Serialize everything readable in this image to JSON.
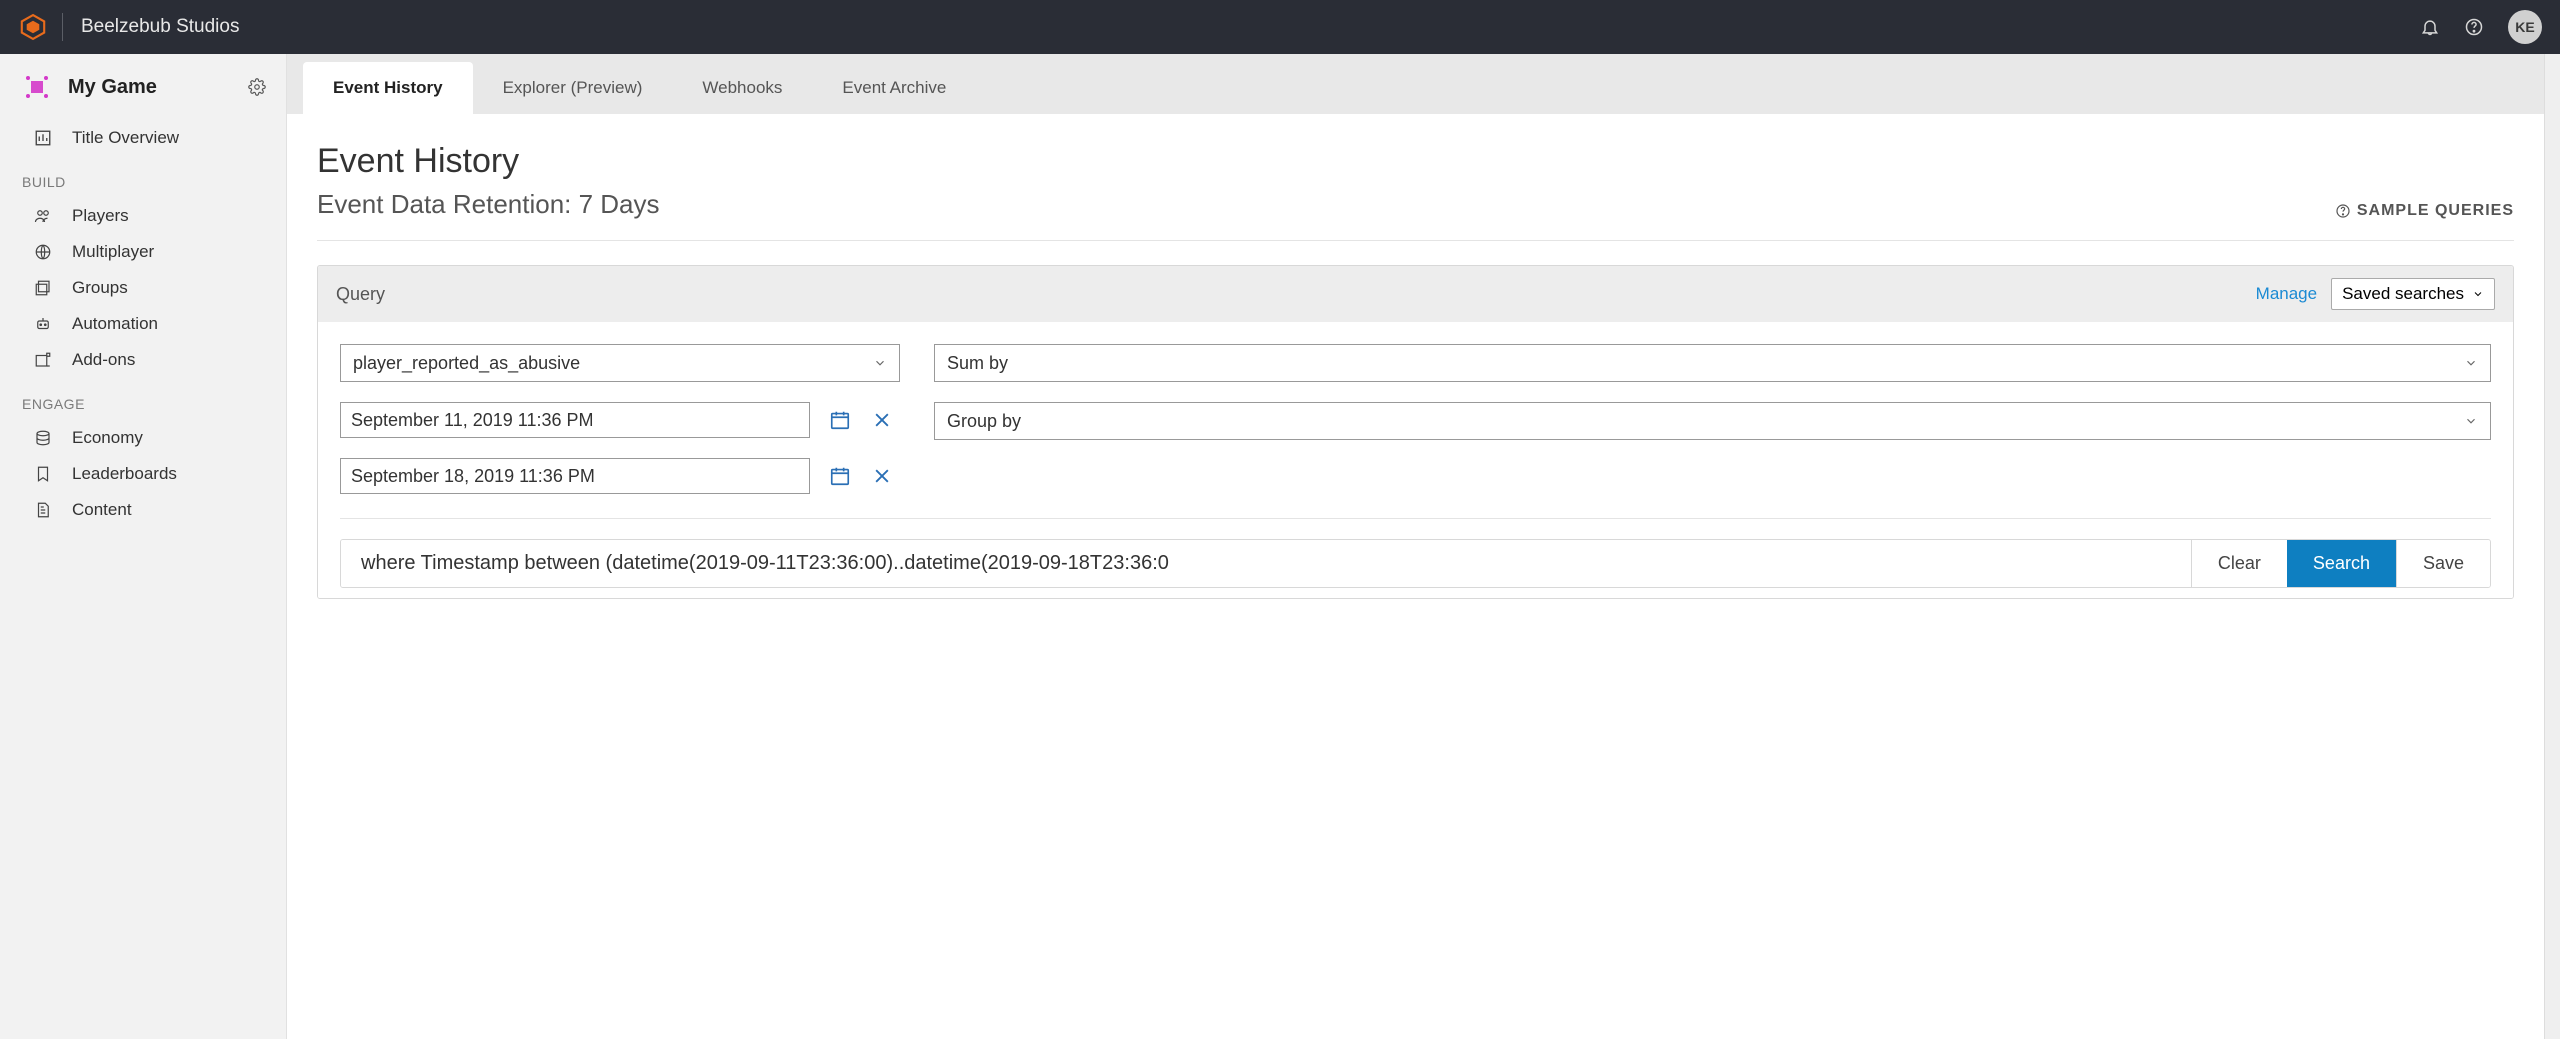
{
  "header": {
    "studio_name": "Beelzebub Studios",
    "user_initials": "KE"
  },
  "sidebar": {
    "project_name": "My Game",
    "items_title_overview": "Title Overview",
    "build_heading": "BUILD",
    "build_items": {
      "players": "Players",
      "multiplayer": "Multiplayer",
      "groups": "Groups",
      "automation": "Automation",
      "addons": "Add-ons"
    },
    "engage_heading": "ENGAGE",
    "engage_items": {
      "economy": "Economy",
      "leaderboards": "Leaderboards",
      "content": "Content"
    }
  },
  "tabs": {
    "event_history": "Event History",
    "explorer": "Explorer (Preview)",
    "webhooks": "Webhooks",
    "event_archive": "Event Archive"
  },
  "page": {
    "title": "Event History",
    "subtitle": "Event Data Retention: 7 Days",
    "sample_queries": "SAMPLE QUERIES"
  },
  "query_panel": {
    "title": "Query",
    "manage": "Manage",
    "saved_searches_label": "Saved searches",
    "event_name": "player_reported_as_abusive",
    "sum_by": "Sum by",
    "group_by": "Group by",
    "start_date": "September 11, 2019 11:36 PM",
    "end_date": "September 18, 2019 11:36 PM",
    "query_string": "where Timestamp between (datetime(2019-09-11T23:36:00)..datetime(2019-09-18T23:36:0",
    "clear_label": "Clear",
    "search_label": "Search",
    "save_label": "Save"
  }
}
